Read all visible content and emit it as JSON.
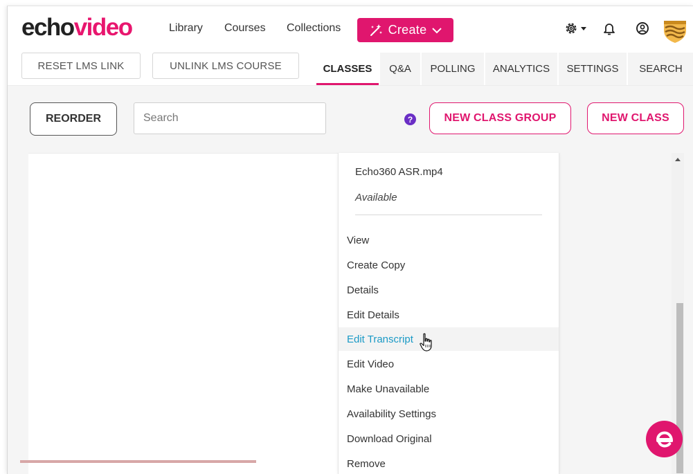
{
  "brand": {
    "logo_echo": "echo",
    "logo_video": "video"
  },
  "nav": {
    "links": [
      "Library",
      "Courses",
      "Collections"
    ],
    "create_label": "Create",
    "icons": [
      "settings-gear-icon",
      "bell-icon",
      "user-profile-icon",
      "institution-logo-icon"
    ]
  },
  "toolbar": {
    "reset_lms": "RESET LMS LINK",
    "unlink_lms": "UNLINK LMS COURSE",
    "tabs": [
      "CLASSES",
      "Q&A",
      "POLLING",
      "ANALYTICS",
      "SETTINGS",
      "SEARCH"
    ],
    "active_tab": "CLASSES"
  },
  "actions": {
    "reorder": "REORDER",
    "search_placeholder": "Search",
    "help": "?",
    "new_class_group": "NEW CLASS GROUP",
    "new_class": "NEW CLASS"
  },
  "menu": {
    "file_name": "Echo360 ASR.mp4",
    "status": "Available",
    "items": [
      "View",
      "Create Copy",
      "Details",
      "Edit Details",
      "Edit Transcript",
      "Edit Video",
      "Make Unavailable",
      "Availability Settings",
      "Download Original",
      "Remove"
    ],
    "hovered_item": "Edit Transcript"
  },
  "colors": {
    "brand_pink": "#e0166e",
    "hover_link": "#1b9ac6",
    "help_purple": "#6a2ec5"
  }
}
